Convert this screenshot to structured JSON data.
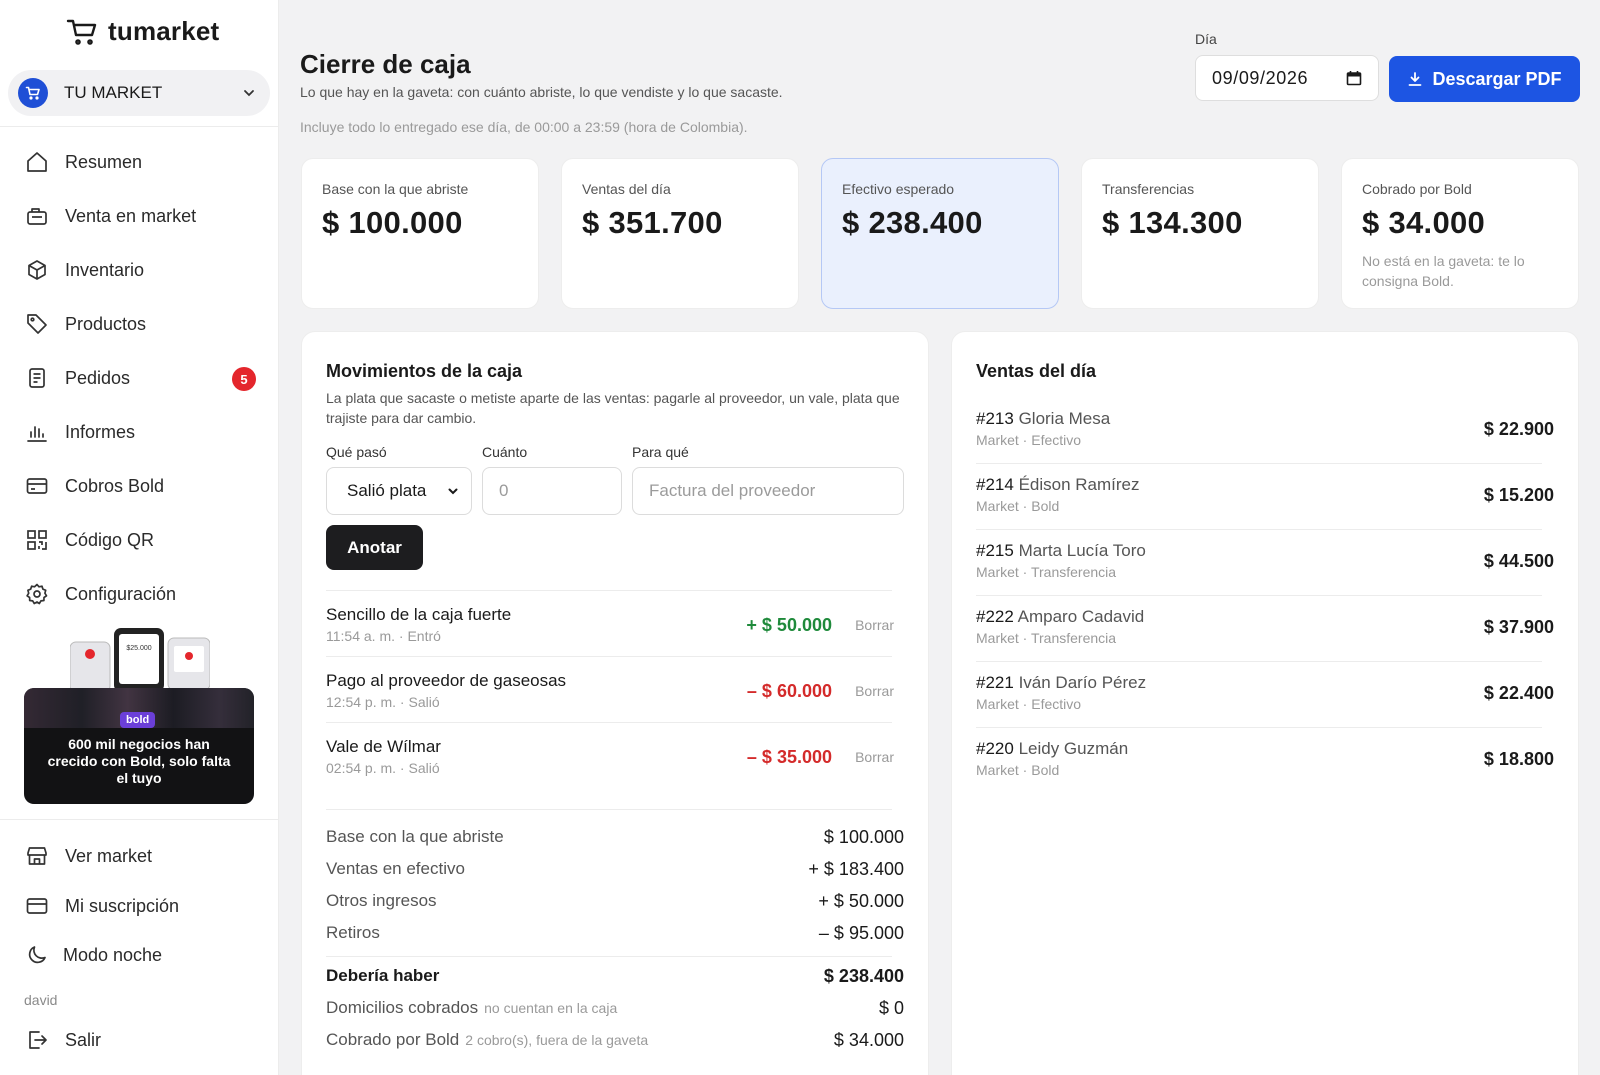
{
  "sidebar": {
    "brand": "tumarket",
    "store": "TU MARKET",
    "nav": [
      {
        "label": "Resumen",
        "icon": "home-icon"
      },
      {
        "label": "Venta en market",
        "icon": "cash-register-icon"
      },
      {
        "label": "Inventario",
        "icon": "box-icon"
      },
      {
        "label": "Productos",
        "icon": "tag-icon"
      },
      {
        "label": "Pedidos",
        "icon": "document-icon",
        "badge": "5"
      },
      {
        "label": "Informes",
        "icon": "bar-chart-icon"
      },
      {
        "label": "Cobros Bold",
        "icon": "credit-card-icon"
      },
      {
        "label": "Código QR",
        "icon": "qr-code-icon"
      },
      {
        "label": "Configuración",
        "icon": "gear-icon"
      }
    ],
    "promo": {
      "logo": "bold",
      "text": "600 mil negocios han crecido con Bold, solo falta el tuyo",
      "device_amount": "$25.000"
    },
    "bottom": [
      {
        "label": "Ver market",
        "icon": "store-icon"
      },
      {
        "label": "Mi suscripción",
        "icon": "card-icon"
      },
      {
        "label": "Modo noche",
        "icon": "moon-icon"
      }
    ],
    "user": "david",
    "logout": "Salir"
  },
  "header": {
    "title": "Cierre de caja",
    "subtitle": "Lo que hay en la gaveta: con cuánto abriste, lo que vendiste y lo que sacaste.",
    "note": "Incluye todo lo entregado ese día, de 00:00 a 23:59 (hora de Colombia).",
    "day_label": "Día",
    "date": "09/09/2026",
    "pdf_button": "Descargar PDF"
  },
  "stats": [
    {
      "label": "Base con la que abriste",
      "value": "$ 100.000"
    },
    {
      "label": "Ventas del día",
      "value": "$ 351.700"
    },
    {
      "label": "Efectivo esperado",
      "value": "$ 238.400"
    },
    {
      "label": "Transferencias",
      "value": "$ 134.300"
    },
    {
      "label": "Cobrado por Bold",
      "value": "$ 34.000",
      "note": "No está en la gaveta: te lo consigna Bold."
    }
  ],
  "movements": {
    "title": "Movimientos de la caja",
    "description": "La plata que sacaste o metiste aparte de las ventas: pagarle al proveedor, un vale, plata que trajiste para dar cambio.",
    "form": {
      "type_label": "Qué pasó",
      "type_value": "Salió plata",
      "amount_label": "Cuánto",
      "amount_placeholder": "0",
      "purpose_label": "Para qué",
      "purpose_placeholder": "Factura del proveedor",
      "submit": "Anotar"
    },
    "items": [
      {
        "name": "Sencillo de la caja fuerte",
        "meta": "11:54 a. m. · Entró",
        "amount": "+ $ 50.000",
        "delete": "Borrar"
      },
      {
        "name": "Pago al proveedor de gaseosas",
        "meta": "12:54 p. m. · Salió",
        "amount": "– $ 60.000",
        "delete": "Borrar"
      },
      {
        "name": "Vale de Wílmar",
        "meta": "02:54 p. m. · Salió",
        "amount": "– $ 35.000",
        "delete": "Borrar"
      }
    ],
    "summary": [
      {
        "label": "Base con la que abriste",
        "value": "$ 100.000"
      },
      {
        "label": "Ventas en efectivo",
        "value": "+ $ 183.400"
      },
      {
        "label": "Otros ingresos",
        "value": "+ $ 50.000"
      },
      {
        "label": "Retiros",
        "value": "– $ 95.000"
      }
    ],
    "total": {
      "label": "Debería haber",
      "value": "$ 238.400"
    },
    "extras": [
      {
        "label": "Domicilios cobrados",
        "hint": "no cuentan en la caja",
        "value": "$ 0"
      },
      {
        "label": "Cobrado por Bold",
        "hint": "2 cobro(s), fuera de la gaveta",
        "value": "$ 34.000"
      }
    ]
  },
  "sales": {
    "title": "Ventas del día",
    "items": [
      {
        "number": "#213",
        "customer": "Gloria Mesa",
        "meta": "Market · Efectivo",
        "amount": "$ 22.900"
      },
      {
        "number": "#214",
        "customer": "Édison Ramírez",
        "meta": "Market · Bold",
        "amount": "$ 15.200"
      },
      {
        "number": "#215",
        "customer": "Marta Lucía Toro",
        "meta": "Market · Transferencia",
        "amount": "$ 44.500"
      },
      {
        "number": "#222",
        "customer": "Amparo Cadavid",
        "meta": "Market · Transferencia",
        "amount": "$ 37.900"
      },
      {
        "number": "#221",
        "customer": "Iván Darío Pérez",
        "meta": "Market · Efectivo",
        "amount": "$ 22.400"
      },
      {
        "number": "#220",
        "customer": "Leidy Guzmán",
        "meta": "Market · Bold",
        "amount": "$ 18.800"
      }
    ]
  },
  "colors": {
    "accent": "#1d55e3",
    "positive": "#1f8a3b",
    "negative": "#d42a2a",
    "badge": "#e4262c"
  }
}
